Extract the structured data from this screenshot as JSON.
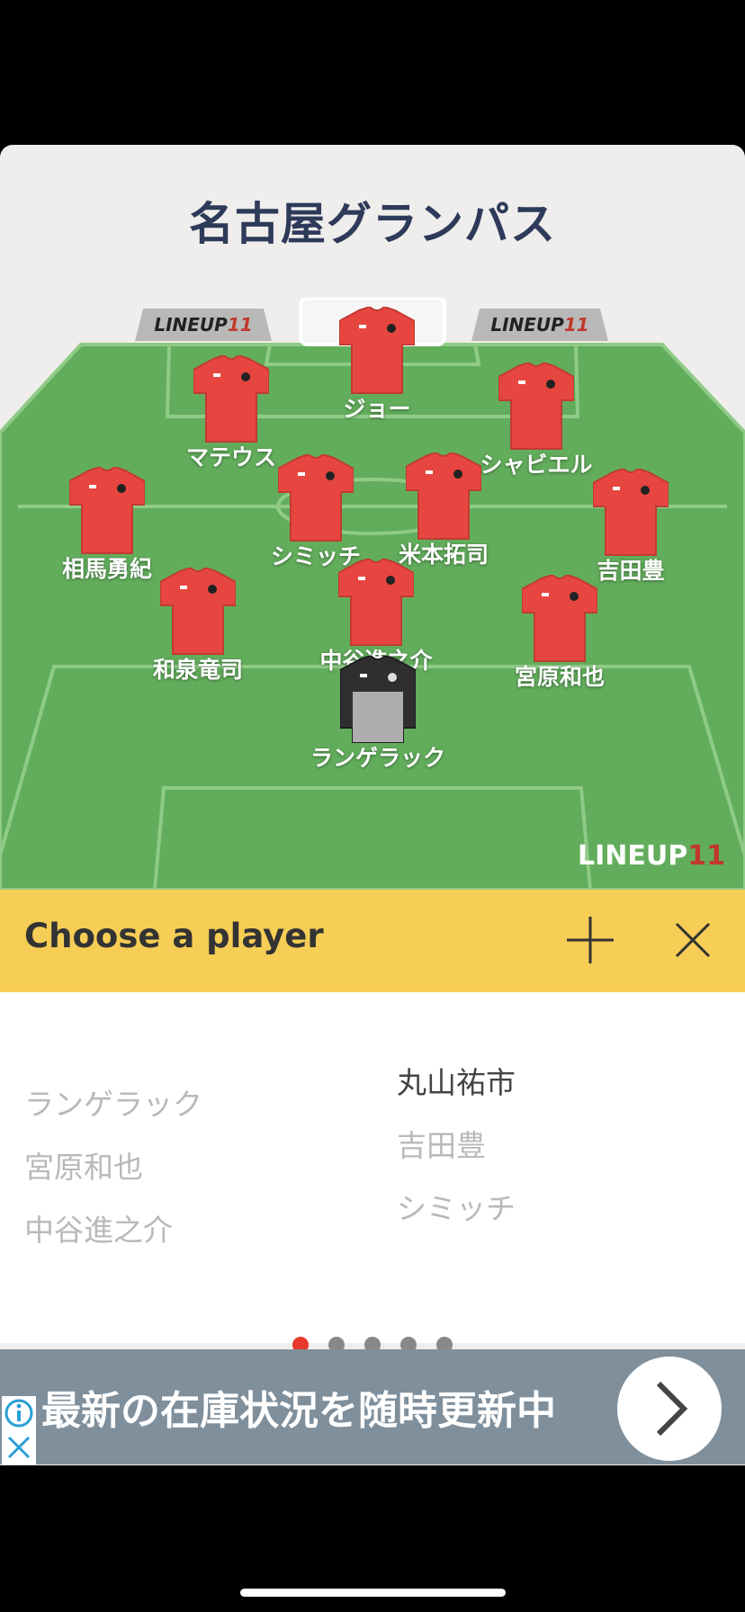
{
  "team": {
    "name": "名古屋グランパス"
  },
  "brand": {
    "boards": [
      {
        "a": "LINEUP",
        "b": "11"
      },
      {
        "a": "LINEUP",
        "b": "11"
      }
    ],
    "watermark": {
      "a": "LINEUP",
      "b": "11"
    }
  },
  "colors": {
    "pitch": "#62ad5c",
    "jersey": "#e74640",
    "keeper": "#2f2f2f",
    "chooser": "#f6cd55",
    "accent": "#e53a2d"
  },
  "players": [
    {
      "name": "ジョー",
      "kit": "field"
    },
    {
      "name": "マテウス",
      "kit": "field"
    },
    {
      "name": "シャビエル",
      "kit": "field"
    },
    {
      "name": "相馬勇紀",
      "kit": "field"
    },
    {
      "name": "シミッチ",
      "kit": "field"
    },
    {
      "name": "米本拓司",
      "kit": "field"
    },
    {
      "name": "吉田豊",
      "kit": "field"
    },
    {
      "name": "和泉竜司",
      "kit": "field"
    },
    {
      "name": "中谷進之介",
      "kit": "field"
    },
    {
      "name": "宮原和也",
      "kit": "field"
    },
    {
      "name": "ランゲラック",
      "kit": "keeper"
    }
  ],
  "chooser": {
    "title": "Choose a player",
    "add_icon": "plus-icon",
    "close_icon": "close-icon"
  },
  "player_list": {
    "left": [
      "ランゲラック",
      "宮原和也",
      "中谷進之介"
    ],
    "right": [
      "丸山祐市",
      "吉田豊",
      "シミッチ"
    ]
  },
  "pagination": {
    "count": 5,
    "active": 1
  },
  "ad": {
    "text": "最新の在庫状況を随時更新中",
    "info_icon": "info-icon",
    "close_icon": "close-icon",
    "arrow_icon": "chevron-right-icon"
  }
}
